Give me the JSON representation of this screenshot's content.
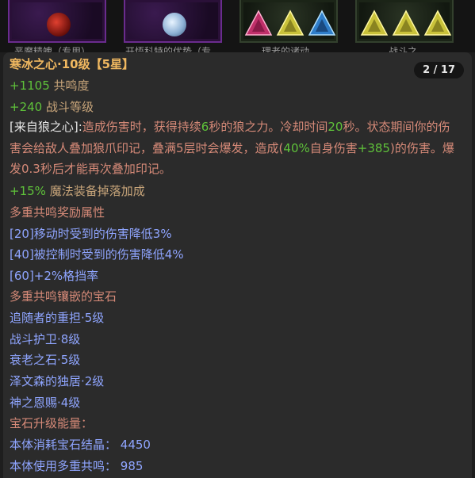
{
  "top_strip": {
    "slots": [
      {
        "kind": "purple",
        "label": "恶魔精魄（专用）"
      },
      {
        "kind": "purple",
        "label": "开悟科特的优势（专"
      },
      {
        "kind": "dark",
        "label": "理老的诸动"
      },
      {
        "kind": "dark",
        "label": "战斗之"
      }
    ]
  },
  "tooltip": {
    "pager": "2 / 17",
    "title_name": "寒冰之心·10级",
    "title_stars": "【5星】",
    "stat1_value": "+1105",
    "stat1_label": "共鸣度",
    "stat2_value": "+240",
    "stat2_label": "战斗等级",
    "effect": {
      "tag": "[来自狼之心]:",
      "t1": "造成伤害时，获得持续",
      "n1": "6",
      "t2": "秒的狼之力。冷却时间",
      "n2": "20",
      "t3": "秒。状态期间你的伤害会给敌人叠加狼爪印记，叠满5层时会爆发，造成(",
      "n3": "40%",
      "t4": "自身伤害",
      "n4": "+385",
      "t5": ")的伤害。爆发0.3秒后才能再次叠加印记。"
    },
    "stat3_value": "+15%",
    "stat3_label": "魔法装备掉落加成",
    "bonus_heading": "多重共鸣奖励属性",
    "bonus1": "[20]移动时受到的伤害降低3%",
    "bonus2": "[40]被控制时受到的伤害降低4%",
    "bonus3": "[60]+2%格挡率",
    "gems_heading": "多重共鸣镶嵌的宝石",
    "gem1": "追随者的重担·5级",
    "gem2": "战斗护卫·8级",
    "gem3": "衰老之石·5级",
    "gem4": "泽文森的独居·2级",
    "gem5": "神之恩赐·4级",
    "upgrade_heading": "宝石升级能量：",
    "cost1_label": "本体消耗宝石结晶：",
    "cost1_value": "4450",
    "cost2_label": "本体使用多重共鸣：",
    "cost2_value": "985"
  }
}
